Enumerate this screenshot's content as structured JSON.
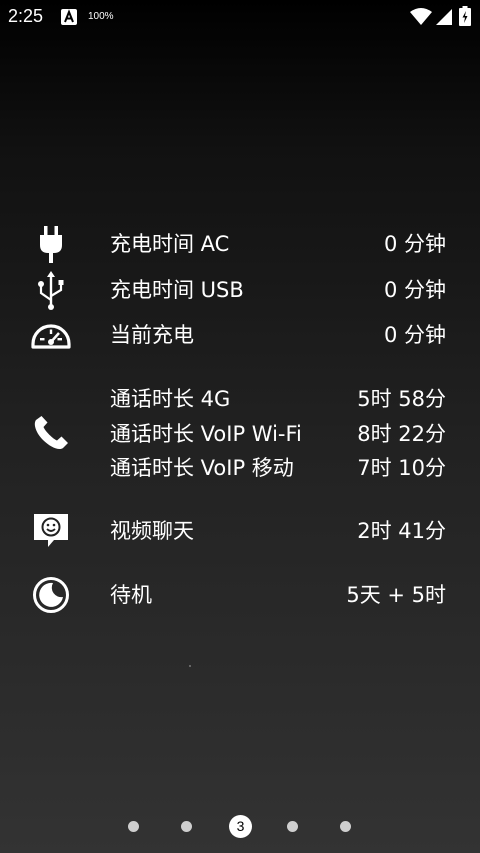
{
  "status_bar": {
    "time": "2:25",
    "battery_percent": "100%",
    "icons": [
      "a-badge-icon",
      "wifi-icon",
      "signal-icon",
      "battery-icon"
    ]
  },
  "stats": {
    "charging": [
      {
        "icon": "plug-icon",
        "label": "充电时间 AC",
        "value": "0 分钟"
      },
      {
        "icon": "usb-icon",
        "label": "充电时间 USB",
        "value": "0 分钟"
      },
      {
        "icon": "speedometer-icon",
        "label": "当前充电",
        "value": "0 分钟"
      }
    ],
    "calls": {
      "icon": "phone-icon",
      "items": [
        {
          "label": "通话时长 4G",
          "value": "5时 58分"
        },
        {
          "label": "通话时长 VoIP Wi-Fi",
          "value": "8时 22分"
        },
        {
          "label": "通话时长 VoIP 移动",
          "value": "7时 10分"
        }
      ]
    },
    "video_chat": {
      "icon": "video-chat-icon",
      "label": "视频聊天",
      "value": "2时 41分"
    },
    "standby": {
      "icon": "moon-icon",
      "label": "待机",
      "value": "5天 + 5时"
    }
  },
  "page_indicator": {
    "total": 5,
    "current": "3"
  }
}
